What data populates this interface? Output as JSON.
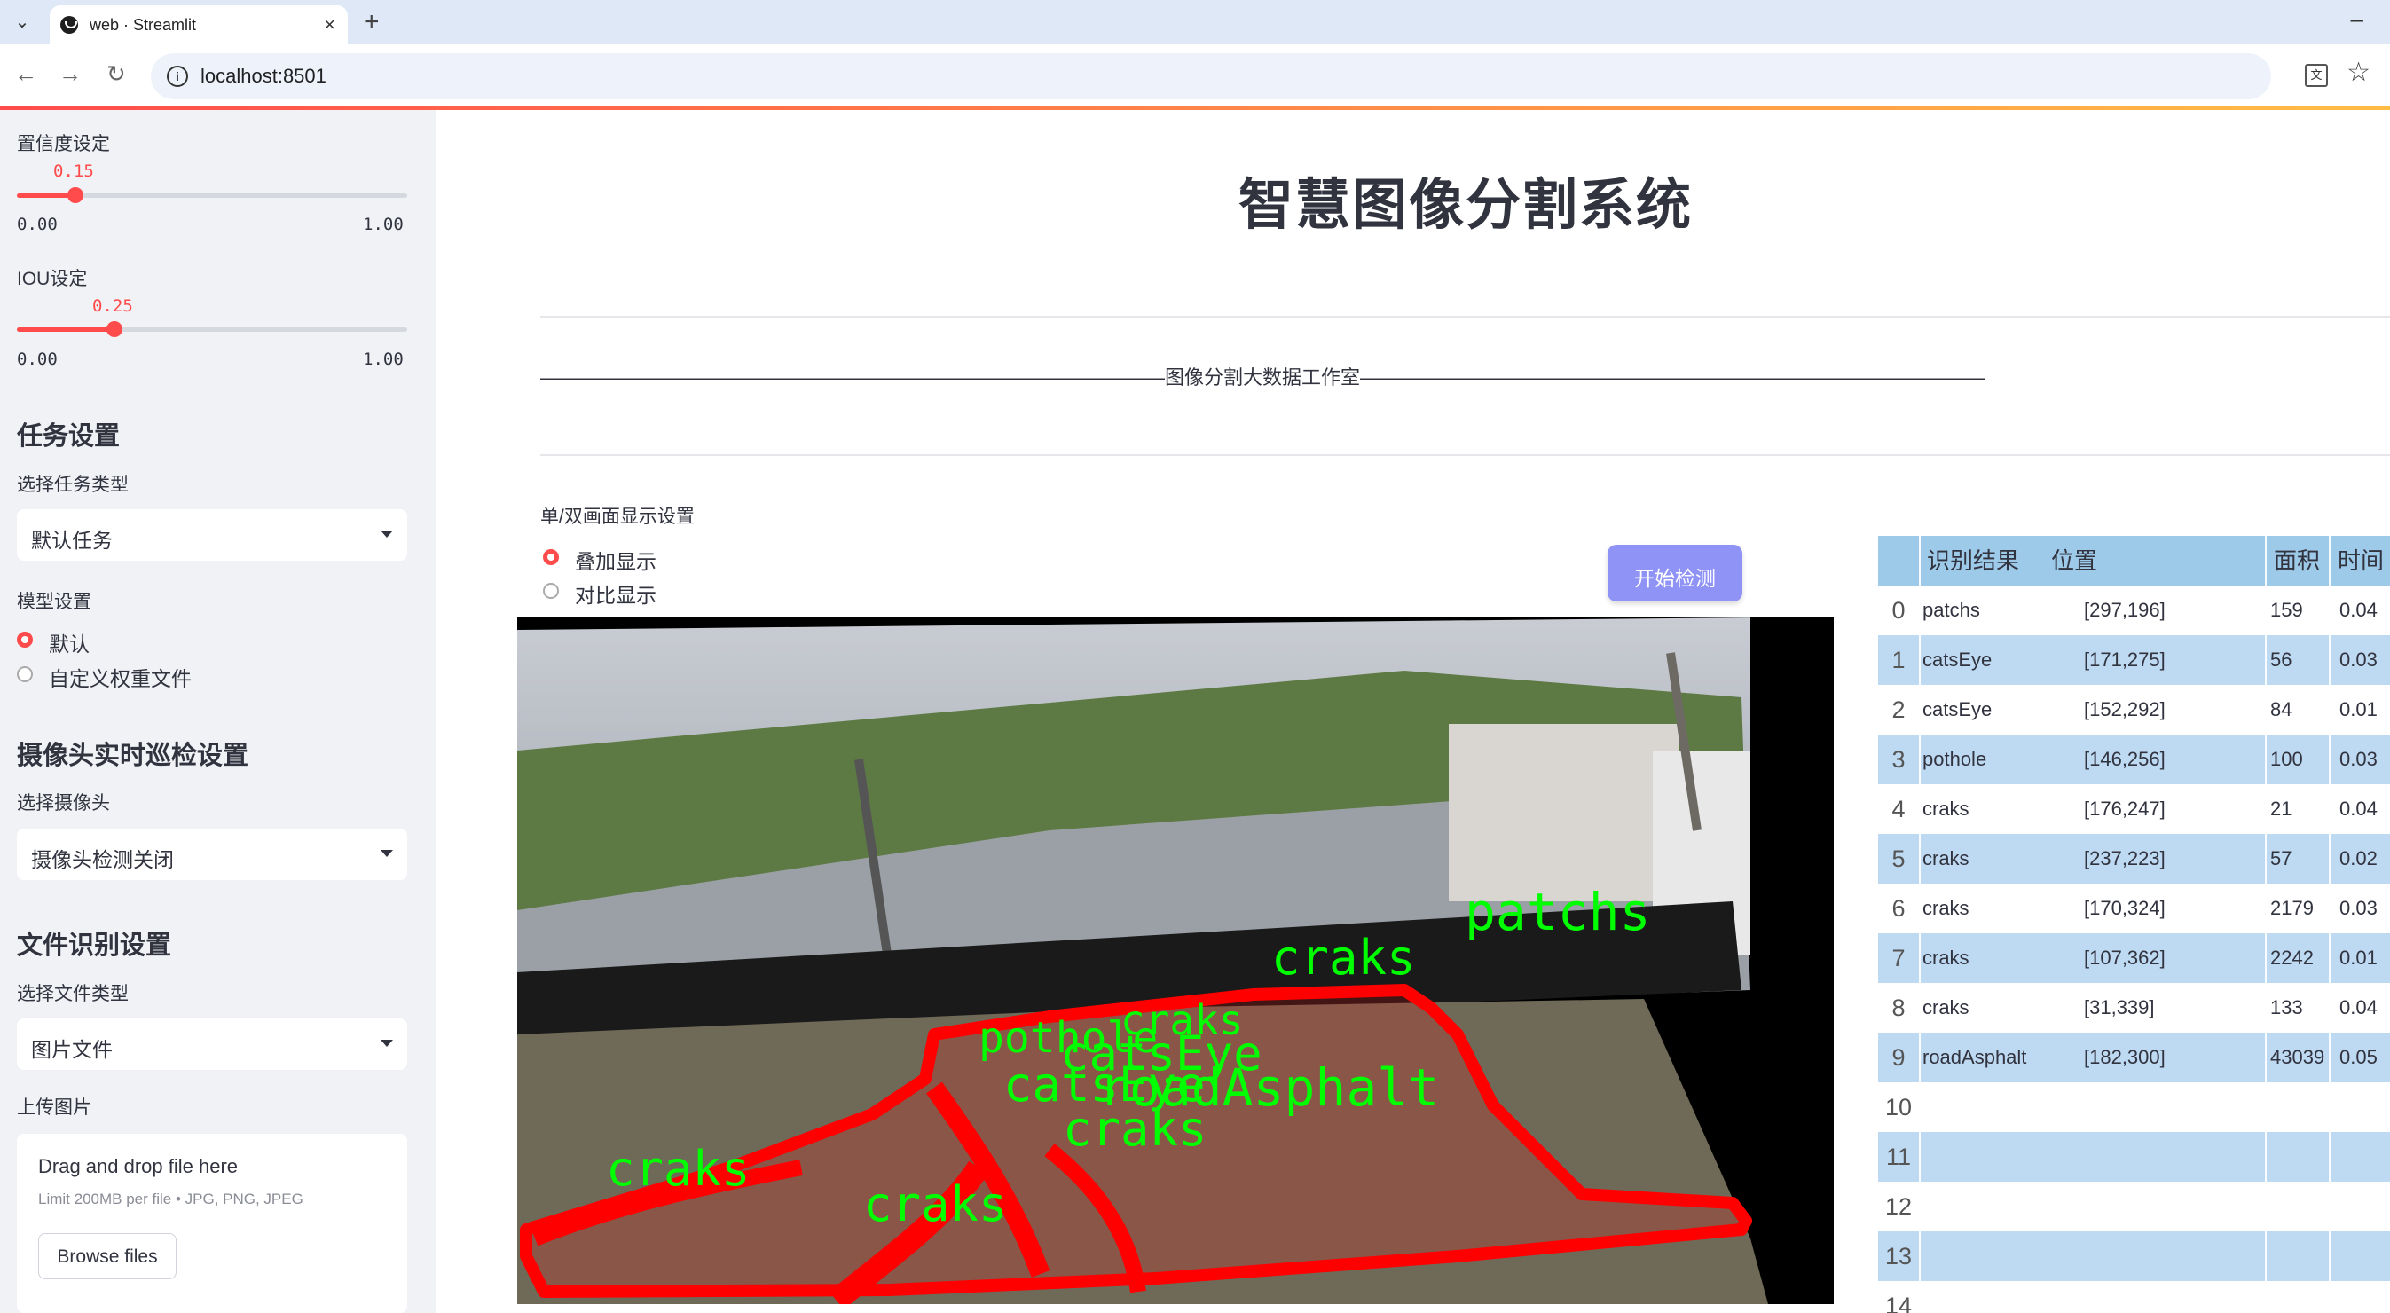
{
  "browser": {
    "tab_title": "web · Streamlit",
    "url": "localhost:8501"
  },
  "sidebar": {
    "confidence": {
      "label": "置信度设定",
      "value": "0.15",
      "min": "0.00",
      "max": "1.00",
      "fraction": 0.15
    },
    "iou": {
      "label": "IOU设定",
      "value": "0.25",
      "min": "0.00",
      "max": "1.00",
      "fraction": 0.25
    },
    "task_settings": {
      "heading": "任务设置",
      "task_type_label": "选择任务类型",
      "task_type_value": "默认任务"
    },
    "model_settings": {
      "label": "模型设置",
      "options": [
        "默认",
        "自定义权重文件"
      ],
      "selected": 0
    },
    "camera": {
      "heading": "摄像头实时巡检设置",
      "select_label": "选择摄像头",
      "select_value": "摄像头检测关闭"
    },
    "file": {
      "heading": "文件识别设置",
      "type_label": "选择文件类型",
      "type_value": "图片文件",
      "upload_label": "上传图片",
      "drop_text": "Drag and drop file here",
      "limit_text": "Limit 200MB per file • JPG, PNG, JPEG",
      "browse_label": "Browse files"
    }
  },
  "main": {
    "title": "智慧图像分割系统",
    "banner": "————————————————————————————————图像分割大数据工作室————————————————————————————————",
    "display_label": "单/双画面显示设置",
    "display_options": [
      "叠加显示",
      "对比显示"
    ],
    "display_selected": 0,
    "start_button": "开始检测",
    "overlay_labels": [
      "patchs",
      "craks",
      "craks",
      "pothole",
      "catsEye",
      "catsEye",
      "roadAsphalt",
      "craks",
      "craks",
      "craks"
    ]
  },
  "table": {
    "headers": [
      "识别结果",
      "位置",
      "面积",
      "时间"
    ],
    "rows": [
      {
        "idx": "0",
        "result": "patchs",
        "pos": "[297,196]",
        "area": "159",
        "time": "0.04"
      },
      {
        "idx": "1",
        "result": "catsEye",
        "pos": "[171,275]",
        "area": "56",
        "time": "0.03"
      },
      {
        "idx": "2",
        "result": "catsEye",
        "pos": "[152,292]",
        "area": "84",
        "time": "0.01"
      },
      {
        "idx": "3",
        "result": "pothole",
        "pos": "[146,256]",
        "area": "100",
        "time": "0.03"
      },
      {
        "idx": "4",
        "result": "craks",
        "pos": "[176,247]",
        "area": "21",
        "time": "0.04"
      },
      {
        "idx": "5",
        "result": "craks",
        "pos": "[237,223]",
        "area": "57",
        "time": "0.02"
      },
      {
        "idx": "6",
        "result": "craks",
        "pos": "[170,324]",
        "area": "2179",
        "time": "0.03"
      },
      {
        "idx": "7",
        "result": "craks",
        "pos": "[107,362]",
        "area": "2242",
        "time": "0.01"
      },
      {
        "idx": "8",
        "result": "craks",
        "pos": "[31,339]",
        "area": "133",
        "time": "0.04"
      },
      {
        "idx": "9",
        "result": "roadAsphalt",
        "pos": "[182,300]",
        "area": "43039",
        "time": "0.05"
      },
      {
        "idx": "10",
        "result": "",
        "pos": "",
        "area": "",
        "time": ""
      },
      {
        "idx": "11",
        "result": "",
        "pos": "",
        "area": "",
        "time": ""
      },
      {
        "idx": "12",
        "result": "",
        "pos": "",
        "area": "",
        "time": ""
      },
      {
        "idx": "13",
        "result": "",
        "pos": "",
        "area": "",
        "time": ""
      },
      {
        "idx": "14",
        "result": "",
        "pos": "",
        "area": "",
        "time": ""
      }
    ]
  },
  "colors": {
    "accent": "#ff4b4b",
    "button": "#8f93f5",
    "table_header": "#9ecae9",
    "table_alt": "#bed9f2",
    "mask": "#ff0000",
    "label": "#00ff00"
  }
}
